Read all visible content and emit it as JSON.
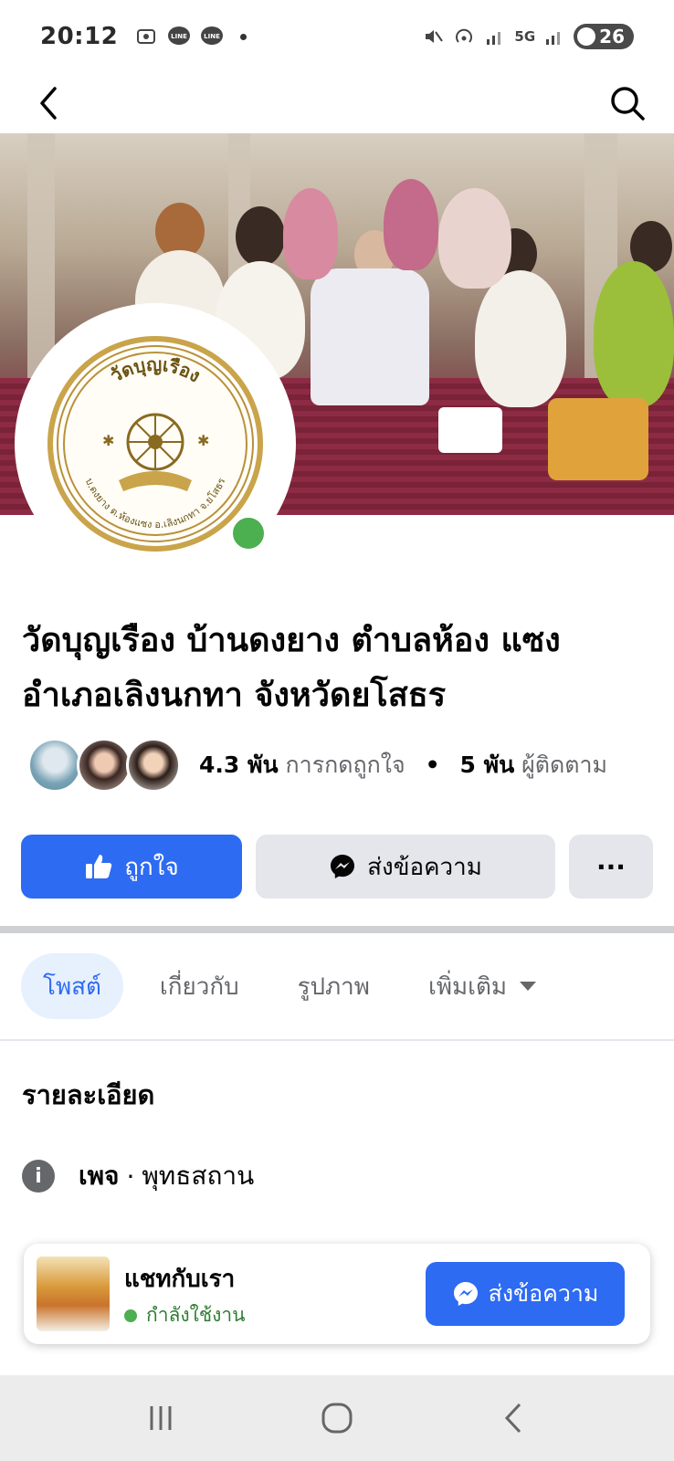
{
  "status_bar": {
    "time": "20:12",
    "network": "5G",
    "battery": "26",
    "left_icons": [
      "screenshot-icon",
      "line-icon",
      "line-icon",
      "dot"
    ],
    "right_icons": [
      "mute-icon",
      "hotspot-icon",
      "signal-icon",
      "5g-icon",
      "signal-icon"
    ]
  },
  "nav": {
    "back_icon": "chevron-left-icon",
    "search_icon": "search-icon"
  },
  "page": {
    "name": "วัดบุญเรือง บ้านดงยาง ตำบลห้อง แซง อำเภอเลิงนกทา จังหวัดยโสธร",
    "likes_count": "4.3 พัน",
    "likes_label": "การกดถูกใจ",
    "followers_count": "5 พัน",
    "followers_label": "ผู้ติดตาม",
    "seal_text_top": "วัดบุญเรือง",
    "seal_text_bottom": "บ.ดงยาง ต.ห้องแซง อ.เลิงนกทา จ.ยโสธร"
  },
  "actions": {
    "like_label": "ถูกใจ",
    "message_label": "ส่งข้อความ",
    "more_label": "···"
  },
  "tabs": [
    {
      "label": "โพสต์",
      "active": true
    },
    {
      "label": "เกี่ยวกับ",
      "active": false
    },
    {
      "label": "รูปภาพ",
      "active": false
    },
    {
      "label": "เพิ่มเติม",
      "active": false
    }
  ],
  "details": {
    "title": "รายละเอียด",
    "category_prefix": "เพจ",
    "category": "พุทธสถาน"
  },
  "chat": {
    "title": "แชทกับเรา",
    "status": "กำลังใช้งาน",
    "button_label": "ส่งข้อความ"
  },
  "colors": {
    "brand_blue": "#2d6bf2",
    "online_green": "#4caf50",
    "button_gray": "#e4e6eb"
  }
}
